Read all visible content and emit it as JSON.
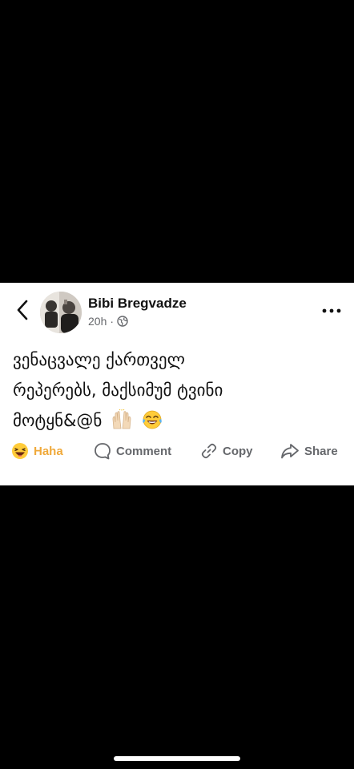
{
  "post": {
    "author": "Bibi Bregvadze",
    "timestamp": "20h",
    "separator": "·",
    "privacy_icon": "globe-icon",
    "text_lines": [
      "ვენაცვალე ქართველ",
      "რეპერებს, მაქსიმუმ ტვინი",
      "მოტყნ&@ნ"
    ],
    "emojis": [
      "raising-hands-icon",
      "tears-of-joy-icon"
    ]
  },
  "actions": {
    "haha_label": "Haha",
    "comment_label": "Comment",
    "copy_label": "Copy",
    "share_label": "Share"
  },
  "colors": {
    "haha": "#f0a93a",
    "action_text": "#65676b",
    "card_bg": "#ffffff",
    "page_bg": "#000000"
  }
}
